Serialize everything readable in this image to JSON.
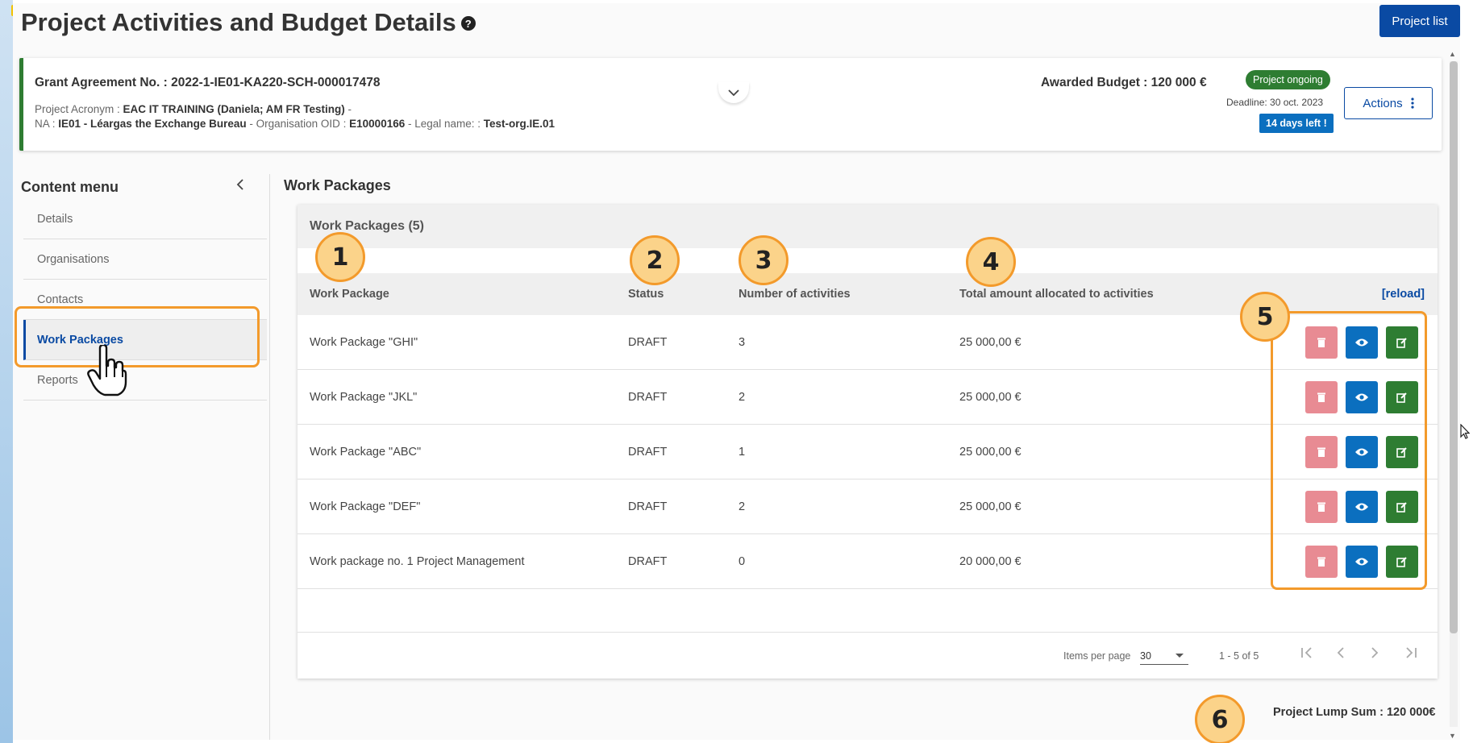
{
  "page": {
    "title": "Project Activities and Budget Details",
    "project_list_label": "Project list"
  },
  "grant": {
    "agreement": "Grant Agreement No. : 2022-1-IE01-KA220-SCH-000017478",
    "acronym_prefix": "Project Acronym : ",
    "acronym_value": "EAC IT TRAINING (Daniela; AM FR Testing)",
    "acronym_suffix": " -",
    "na_prefix": "NA : ",
    "na_value": "IE01 - Léargas the Exchange Bureau",
    "oid_prefix": " - Organisation OID : ",
    "oid_value": "E10000166",
    "legal_prefix": " - Legal name: : ",
    "legal_value": "Test-org.IE.01",
    "awarded_budget": "Awarded Budget : 120 000 €",
    "status_badge": "Project ongoing",
    "deadline": "Deadline: 30 oct. 2023",
    "days_left": "14 days left !",
    "actions_label": "Actions"
  },
  "sidebar": {
    "title": "Content menu",
    "items": [
      {
        "label": "Details"
      },
      {
        "label": "Organisations"
      },
      {
        "label": "Contacts"
      },
      {
        "label": "Work Packages"
      },
      {
        "label": "Reports"
      }
    ]
  },
  "main": {
    "section_title": "Work Packages",
    "card_title": "Work Packages (5)",
    "columns": [
      "Work Package",
      "Status",
      "Number of activities",
      "Total amount allocated to activities"
    ],
    "reload_label": "[reload]",
    "rows": [
      {
        "name": "Work Package \"GHI\"",
        "status": "DRAFT",
        "activities": "3",
        "amount": "25 000,00 €"
      },
      {
        "name": "Work Package \"JKL\"",
        "status": "DRAFT",
        "activities": "2",
        "amount": "25 000,00 €"
      },
      {
        "name": "Work Package \"ABC\"",
        "status": "DRAFT",
        "activities": "1",
        "amount": "25 000,00 €"
      },
      {
        "name": "Work Package \"DEF\"",
        "status": "DRAFT",
        "activities": "2",
        "amount": "25 000,00 €"
      },
      {
        "name": "Work package no. 1 Project Management",
        "status": "DRAFT",
        "activities": "0",
        "amount": "20 000,00 €"
      }
    ],
    "pagination": {
      "items_per_page_label": "Items per page",
      "items_per_page_value": "30",
      "range": "1 - 5 of 5"
    },
    "lump_sum": "Project Lump Sum : 120 000€"
  },
  "annotations": [
    "1",
    "2",
    "3",
    "4",
    "5",
    "6"
  ],
  "colors": {
    "primary": "#0a4aa3",
    "success": "#2e7d32",
    "info": "#0b6fbf",
    "danger_disabled": "#e88b93",
    "annotation": "#f39a2b"
  }
}
